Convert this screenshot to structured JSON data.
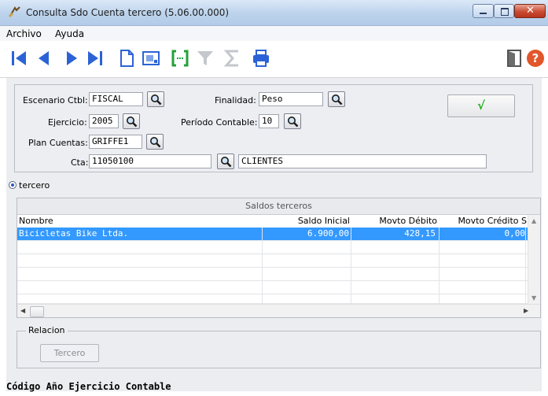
{
  "window": {
    "title": "Consulta Sdo Cuenta tercero (5.06.00.000)"
  },
  "menu": [
    {
      "label": "Archivo"
    },
    {
      "label": "Ayuda"
    }
  ],
  "toolbar": {
    "items": [
      "first-record-icon",
      "previous-record-icon",
      "next-record-icon",
      "last-record-icon",
      "new-document-icon",
      "preview-icon",
      "range-icon",
      "filter-icon",
      "sum-icon",
      "print-icon",
      "exit-door-icon",
      "help-icon"
    ]
  },
  "form": {
    "escenario": {
      "label": "Escenario Ctbl:",
      "value": "FISCAL"
    },
    "finalidad": {
      "label": "Finalidad:",
      "value": "Peso"
    },
    "ejercicio": {
      "label": "Ejercicio:",
      "value": "2005"
    },
    "periodo": {
      "label": "Período Contable:",
      "value": "10"
    },
    "plan": {
      "label": "Plan Cuentas:",
      "value": "GRIFFE1"
    },
    "cta": {
      "label": "Cta:",
      "value": "11050100",
      "description": "CLIENTES"
    },
    "ok_label": "√"
  },
  "radio": {
    "label": "tercero",
    "checked": true
  },
  "grid": {
    "caption": "Saldos terceros",
    "columns": [
      "Nombre",
      "Saldo Inicial",
      "Movto Débito",
      "Movto Crédito S"
    ],
    "rows": [
      {
        "nombre": "Bicicletas Bike Ltda.",
        "saldo_inicial": "6.900,00",
        "debito": "428,15",
        "credito": "0,00"
      }
    ]
  },
  "relacion": {
    "title": "Relacion",
    "button": "Tercero"
  },
  "status": {
    "text": "Código Año Ejercicio Contable"
  },
  "colors": {
    "accent": "#3399ff",
    "ok_green": "#22b41e",
    "toolbar_blue": "#2b63d6"
  }
}
